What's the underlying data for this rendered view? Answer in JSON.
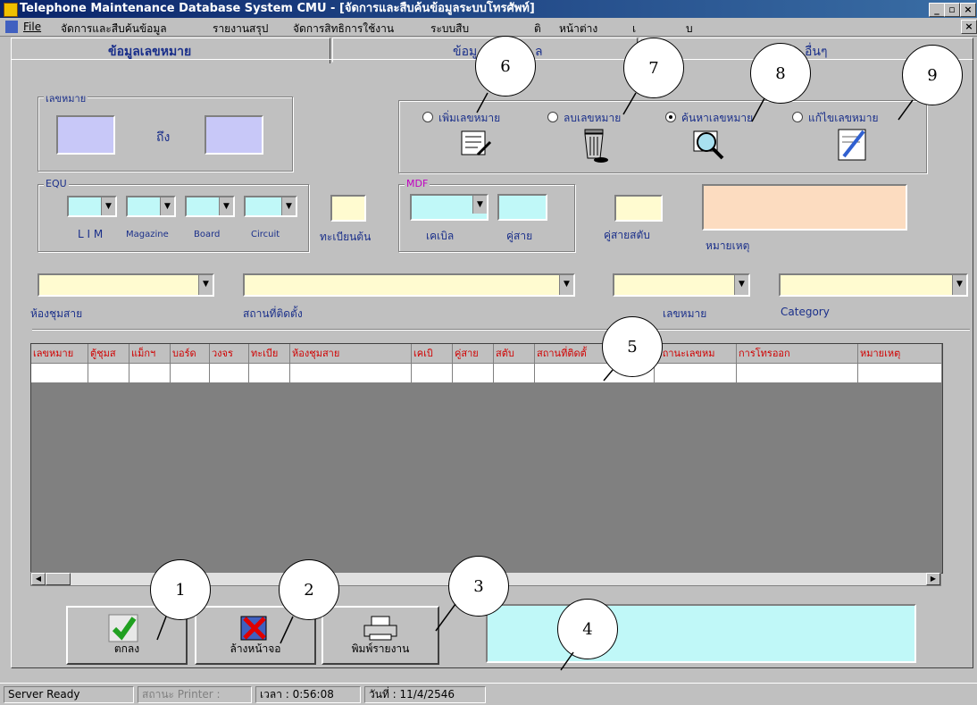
{
  "window": {
    "title": "Telephone Maintenance Database System CMU - [จัดการและสืบค้นข้อมูลระบบโทรศัพท์]"
  },
  "menu": [
    "File",
    "จัดการและสืบค้นข้อมูล",
    "รายงานสรุป",
    "จัดการสิทธิการใช้งาน",
    "ระบบสืบ",
    "ติ",
    "หน้าต่าง",
    "เ",
    "บ"
  ],
  "tabs": [
    "ข้อมูลเลขหมาย",
    "ข้อมู",
    "ล",
    "อื่นๆ"
  ],
  "number_group": {
    "title": "เลขหมาย",
    "to_label": "ถึง"
  },
  "radios": [
    {
      "label": "เพิ่มเลขหมาย",
      "checked": false,
      "icon": "add-document-icon"
    },
    {
      "label": "ลบเลขหมาย",
      "checked": false,
      "icon": "trash-icon"
    },
    {
      "label": "ค้นหาเลขหมาย",
      "checked": true,
      "icon": "search-icon"
    },
    {
      "label": "แก้ไขเลขหมาย",
      "checked": false,
      "icon": "edit-icon"
    }
  ],
  "equ": {
    "title": "EQU",
    "labels": [
      "L I M",
      "Magazine",
      "Board",
      "Circuit"
    ]
  },
  "reg_label": "ทะเบียนต้น",
  "mdf": {
    "title": "MDF",
    "labels": [
      "เคเบิล",
      "คู่สาย"
    ]
  },
  "pair_label": "คู่สายสตับ",
  "note_label": "หมายเหตุ",
  "filters": [
    "ห้องชุมสาย",
    "สถานที่ติดตั้ง",
    "เลขหมาย",
    "Category"
  ],
  "grid": {
    "columns": [
      "เลขหมาย",
      "ตู้ชุมส",
      "แม็กฯ",
      "บอร์ด",
      "วงจร",
      "ทะเบีย",
      "ห้องชุมสาย",
      "เคเบิ",
      "คู่สาย",
      "สตับ",
      "สถานที่ติดตั้",
      "สถานะเลขหม",
      "การโทรออก",
      "หมายเหตุ"
    ]
  },
  "buttons": [
    {
      "label": "ตกลง",
      "icon": "check-icon"
    },
    {
      "label": "ล้างหน้าจอ",
      "icon": "clear-x-icon"
    },
    {
      "label": "พิมพ์รายงาน",
      "icon": "printer-icon"
    }
  ],
  "callouts": [
    "1",
    "2",
    "3",
    "4",
    "5",
    "6",
    "7",
    "8",
    "9"
  ],
  "status": {
    "ready": "Server Ready",
    "printer": "สถานะ Printer :",
    "time": "เวลา : 0:56:08",
    "date": "วันที่ : 11/4/2546"
  },
  "colors": {
    "titlebar": "#0a246a",
    "input_lavender": "#c8c8f8",
    "input_cyan": "#c0f8f8",
    "input_yellow": "#fffbd0",
    "note_peach": "#fcdcc0",
    "header_text": "#d00000"
  }
}
